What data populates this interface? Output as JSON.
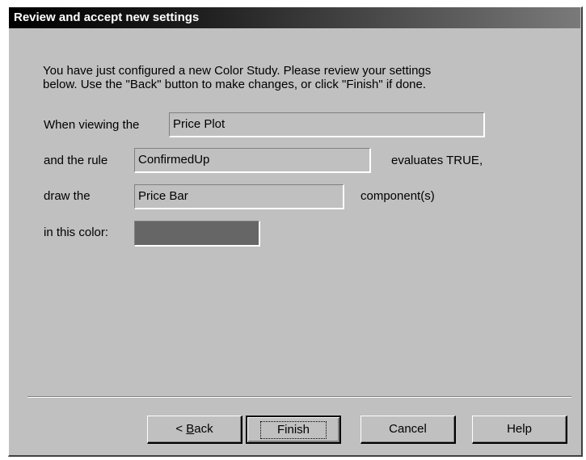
{
  "window": {
    "title": "Review and accept new settings"
  },
  "intro": {
    "line1": "You have just configured a new Color Study.  Please review your settings",
    "line2": "below.  Use the \"Back\" button to make changes, or click \"Finish\" if done."
  },
  "form": {
    "viewing_label": "When viewing the",
    "viewing_value": "Price Plot",
    "rule_label": "and the rule",
    "rule_value": "ConfirmedUp",
    "evaluates_label": "evaluates TRUE,",
    "draw_label": "draw the",
    "draw_value": "Price Bar",
    "component_label": "component(s)",
    "color_label": "in this color:",
    "color_value": "#666666"
  },
  "buttons": {
    "back_prefix": "< ",
    "back_underlined": "B",
    "back_rest": "ack",
    "finish": "Finish",
    "cancel": "Cancel",
    "help": "Help"
  }
}
